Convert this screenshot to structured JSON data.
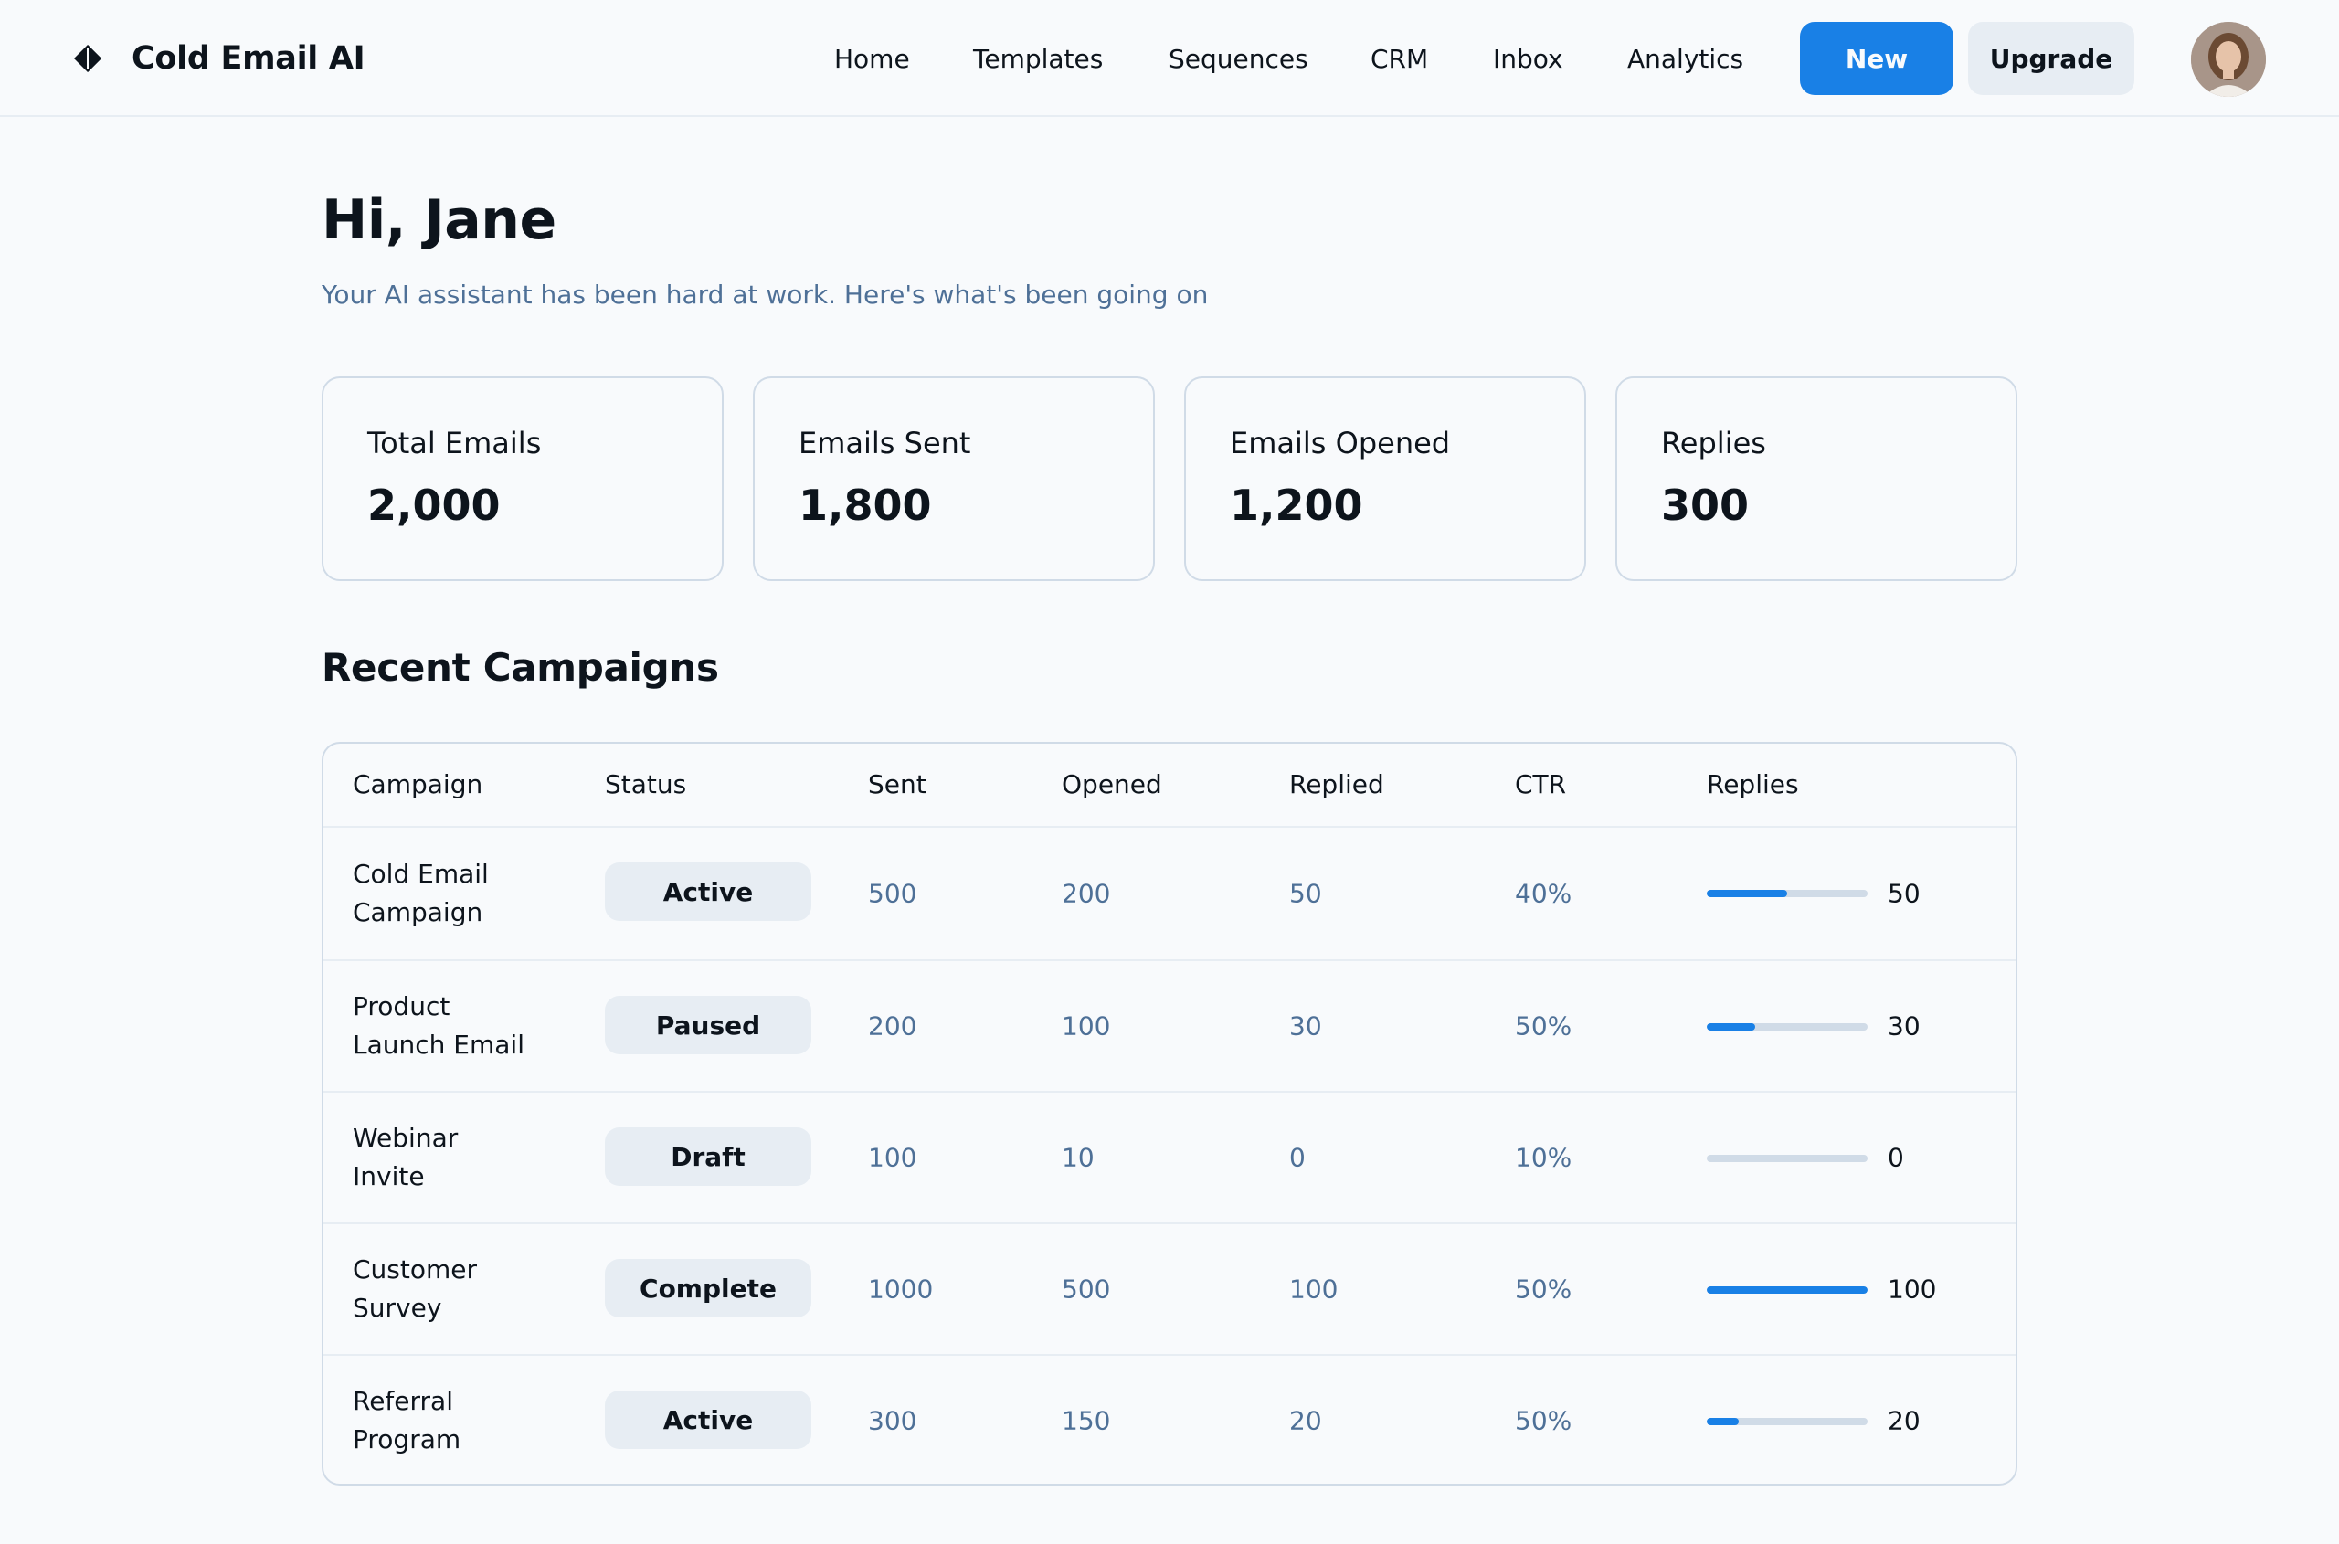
{
  "app": {
    "name": "Cold Email AI",
    "logo_icon": "diamond-logo-icon"
  },
  "nav": {
    "items": [
      "Home",
      "Templates",
      "Sequences",
      "CRM",
      "Inbox",
      "Analytics"
    ]
  },
  "actions": {
    "new_label": "New",
    "upgrade_label": "Upgrade"
  },
  "user": {
    "avatar_icon": "user-avatar"
  },
  "colors": {
    "accent": "#1980e6",
    "muted_text": "#4e7097",
    "border": "#d0dbe7",
    "chip_bg": "#e7edf3"
  },
  "main": {
    "greeting": "Hi, Jane",
    "subtitle": "Your AI assistant has been hard at work. Here's what's been going on",
    "stats": [
      {
        "label": "Total Emails",
        "value": "2,000"
      },
      {
        "label": "Emails Sent",
        "value": "1,800"
      },
      {
        "label": "Emails Opened",
        "value": "1,200"
      },
      {
        "label": "Replies",
        "value": "300"
      }
    ],
    "section_title": "Recent Campaigns",
    "table": {
      "headers": [
        "Campaign",
        "Status",
        "Sent",
        "Opened",
        "Replied",
        "CTR",
        "Replies"
      ],
      "rows": [
        {
          "campaign": "Cold Email Campaign",
          "status": "Active",
          "sent": "500",
          "opened": "200",
          "replied": "50",
          "ctr": "40%",
          "replies": "50",
          "replies_fraction": 0.5
        },
        {
          "campaign": "Product Launch Email",
          "status": "Paused",
          "sent": "200",
          "opened": "100",
          "replied": "30",
          "ctr": "50%",
          "replies": "30",
          "replies_fraction": 0.3
        },
        {
          "campaign": "Webinar Invite",
          "status": "Draft",
          "sent": "100",
          "opened": "10",
          "replied": "0",
          "ctr": "10%",
          "replies": "0",
          "replies_fraction": 0
        },
        {
          "campaign": "Customer Survey",
          "status": "Complete",
          "sent": "1000",
          "opened": "500",
          "replied": "100",
          "ctr": "50%",
          "replies": "100",
          "replies_fraction": 1.0
        },
        {
          "campaign": "Referral Program",
          "status": "Active",
          "sent": "300",
          "opened": "150",
          "replied": "20",
          "ctr": "50%",
          "replies": "20",
          "replies_fraction": 0.2
        }
      ]
    }
  }
}
